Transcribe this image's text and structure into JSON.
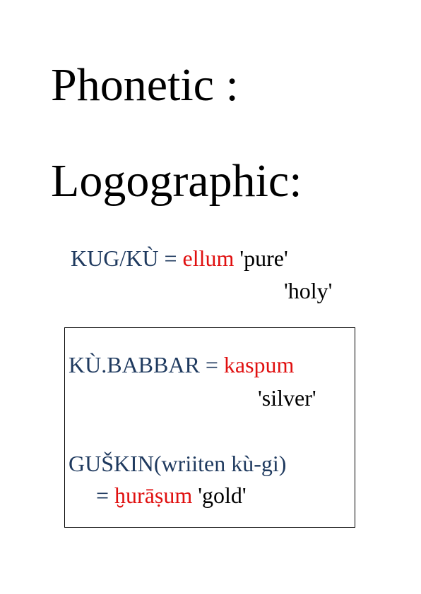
{
  "headings": {
    "phonetic": "Phonetic :",
    "logographic": "Logographic:"
  },
  "entries": {
    "kug": {
      "logogram": "KUG/KÙ",
      "equals": " = ",
      "akkadian": "ellum",
      "gloss_1": " 'pure'",
      "gloss_2": "'holy'"
    },
    "babbar": {
      "logogram": "KÙ.BABBAR",
      "equals": " = ",
      "akkadian": "kaspum",
      "gloss": "'silver'"
    },
    "guskin": {
      "logogram": "GUŠKIN(wriiten kù-gi)",
      "equals": "= ",
      "akkadian": "ḫurāṣum",
      "gloss": " 'gold'"
    }
  },
  "colors": {
    "logogram": "#1f3a5f",
    "akkadian": "#e01010",
    "gloss": "#000000"
  }
}
